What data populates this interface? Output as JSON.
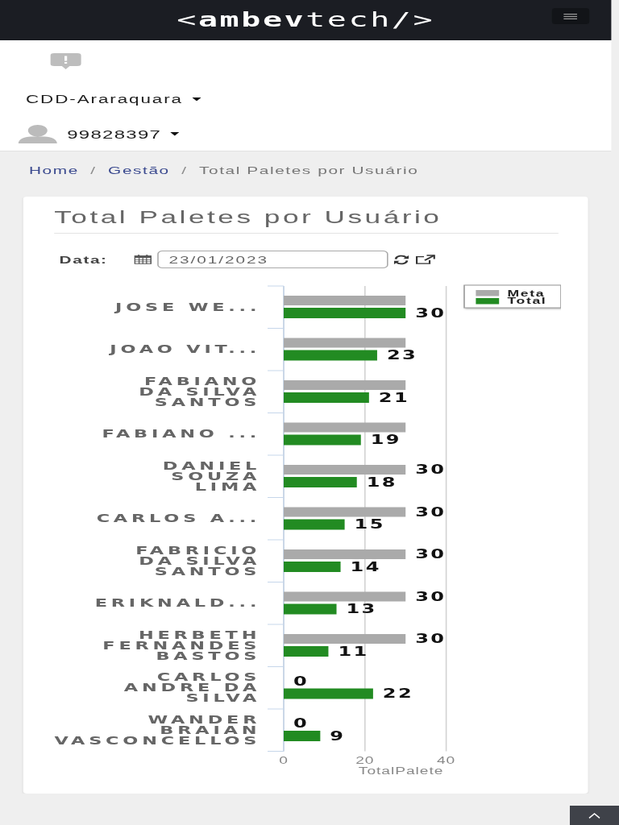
{
  "header": {
    "logo": "<**ambev**tech/>"
  },
  "nav": {
    "location": "CDD-Araraquara",
    "user": "99828397"
  },
  "breadcrumb": {
    "separator": "/",
    "items": [
      {
        "label": "Home",
        "current": false
      },
      {
        "label": "Gestão",
        "current": false
      },
      {
        "label": "Total Paletes por Usuário",
        "current": true
      }
    ]
  },
  "panel": {
    "title": "Total Paletes por Usuário",
    "date_filter": {
      "label": "Data:",
      "value": "23/01/2023"
    },
    "chart_data": {
      "type": "bar",
      "orientation": "horizontal",
      "xlabel": "TotalPalete",
      "legend": "right",
      "categories": [
        "JOSE WE...",
        "JOAO VIT...",
        "FABIANO\nDA SILVA\nSANTOS",
        "FABIANO ...",
        "DANIEL\nSOUZA\nLIMA",
        "CARLOS A...",
        "FABRICIO\nDA SILVA\nSANTOS",
        "ERIKNALD...",
        "HERBETH\nFERNANDES\nBASTOS",
        "CARLOS\nANDRE DA\nSILVA",
        "WANDER\nBRAIAN\nVASCONCELLOS"
      ],
      "series": [
        {
          "name": "Meta",
          "color": "#aaaaaa",
          "values": [
            30,
            30,
            30,
            30,
            30,
            30,
            30,
            30,
            30,
            0,
            0
          ]
        },
        {
          "name": "Total",
          "color": "#228b22",
          "values": [
            30,
            23,
            21,
            19,
            18,
            15,
            14,
            13,
            11,
            22,
            9
          ]
        }
      ],
      "xlim": [
        0,
        40
      ],
      "xticks": [
        0,
        20,
        40
      ],
      "value_labels": [
        [
          null,
          null,
          null,
          null,
          "30",
          "30",
          "30",
          "30",
          "30",
          "0",
          "0"
        ],
        [
          "30",
          "23",
          "21",
          "19",
          "18",
          "15",
          "14",
          "13",
          "11",
          "22",
          "9"
        ]
      ]
    }
  }
}
